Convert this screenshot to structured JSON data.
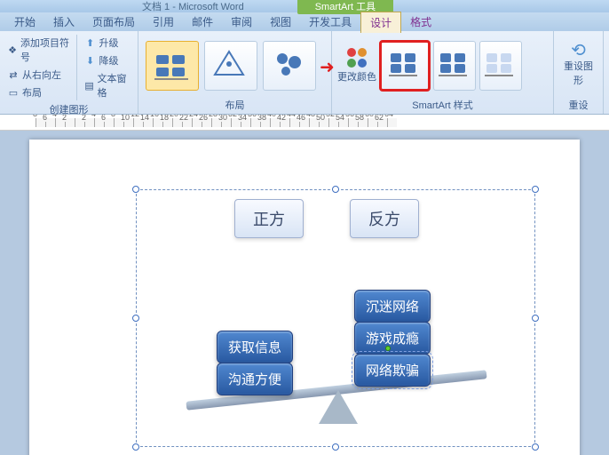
{
  "titlebar": {
    "doc": "文档 1 - Microsoft Word",
    "tool": "SmartArt 工具"
  },
  "menu": {
    "start": "开始",
    "insert": "插入",
    "layout": "页面布局",
    "ref": "引用",
    "mail": "邮件",
    "review": "审阅",
    "view": "视图",
    "dev": "开发工具",
    "design": "设计",
    "format": "格式"
  },
  "ribbon": {
    "group1": {
      "label": "创建图形",
      "add_bullet": "添加项目符号",
      "rtl": "从右向左",
      "layout_btn": "布局",
      "promote": "升级",
      "demote": "降级",
      "text_pane": "文本窗格"
    },
    "group2": {
      "label": "布局"
    },
    "group3": {
      "label": "SmartArt 样式",
      "change_colors": "更改颜色"
    },
    "group4": {
      "label": "重设",
      "reset": "重设图形"
    }
  },
  "ruler": [
    "8",
    "6",
    "4",
    "2",
    "",
    "2",
    "4",
    "6",
    "8",
    "10",
    "12",
    "14",
    "16",
    "18",
    "20",
    "22",
    "24",
    "26",
    "28",
    "30",
    "32",
    "34",
    "36",
    "38",
    "40",
    "42",
    "44",
    "46",
    "48",
    "50",
    "52",
    "54",
    "56",
    "58",
    "60",
    "62",
    "64"
  ],
  "smartart": {
    "label_left": "正方",
    "label_right": "反方",
    "left_items": [
      "获取信息",
      "沟通方便"
    ],
    "right_items": [
      "沉迷网络",
      "游戏成瘾",
      "网络欺骗"
    ]
  }
}
